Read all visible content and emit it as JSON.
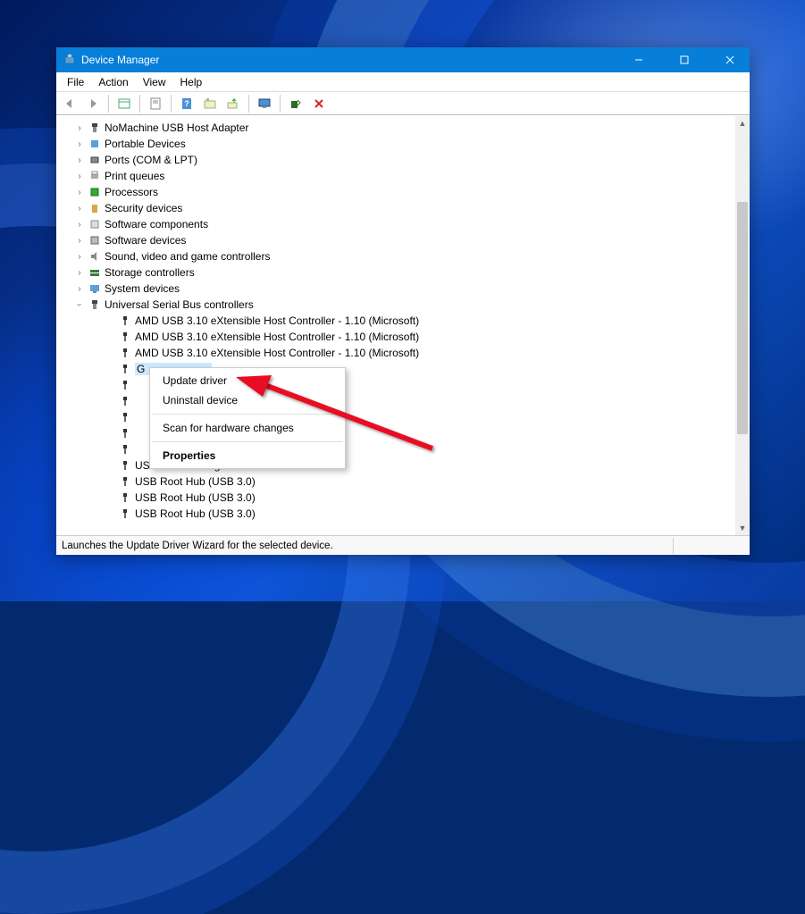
{
  "window": {
    "title": "Device Manager"
  },
  "menubar": [
    "File",
    "Action",
    "View",
    "Help"
  ],
  "tree": {
    "items": [
      {
        "label": "NoMachine USB Host Adapter",
        "icon": "usb-plug"
      },
      {
        "label": "Portable Devices",
        "icon": "portable"
      },
      {
        "label": "Ports (COM & LPT)",
        "icon": "port"
      },
      {
        "label": "Print queues",
        "icon": "printer"
      },
      {
        "label": "Processors",
        "icon": "cpu"
      },
      {
        "label": "Security devices",
        "icon": "security"
      },
      {
        "label": "Software components",
        "icon": "component"
      },
      {
        "label": "Software devices",
        "icon": "software"
      },
      {
        "label": "Sound, video and game controllers",
        "icon": "sound"
      },
      {
        "label": "Storage controllers",
        "icon": "storage"
      },
      {
        "label": "System devices",
        "icon": "system"
      }
    ],
    "usb_category": {
      "label": "Universal Serial Bus controllers",
      "children": [
        "AMD USB 3.10 eXtensible Host Controller - 1.10 (Microsoft)",
        "AMD USB 3.10 eXtensible Host Controller - 1.10 (Microsoft)",
        "AMD USB 3.10 eXtensible Host Controller - 1.10 (Microsoft)",
        "G",
        "",
        "",
        "",
        "",
        "",
        "USB Mass Storage Device",
        "USB Root Hub (USB 3.0)",
        "USB Root Hub (USB 3.0)",
        "USB Root Hub (USB 3.0)"
      ]
    }
  },
  "context_menu": {
    "items": [
      "Update driver",
      "Uninstall device",
      "Scan for hardware changes",
      "Properties"
    ]
  },
  "statusbar": {
    "text": "Launches the Update Driver Wizard for the selected device."
  }
}
